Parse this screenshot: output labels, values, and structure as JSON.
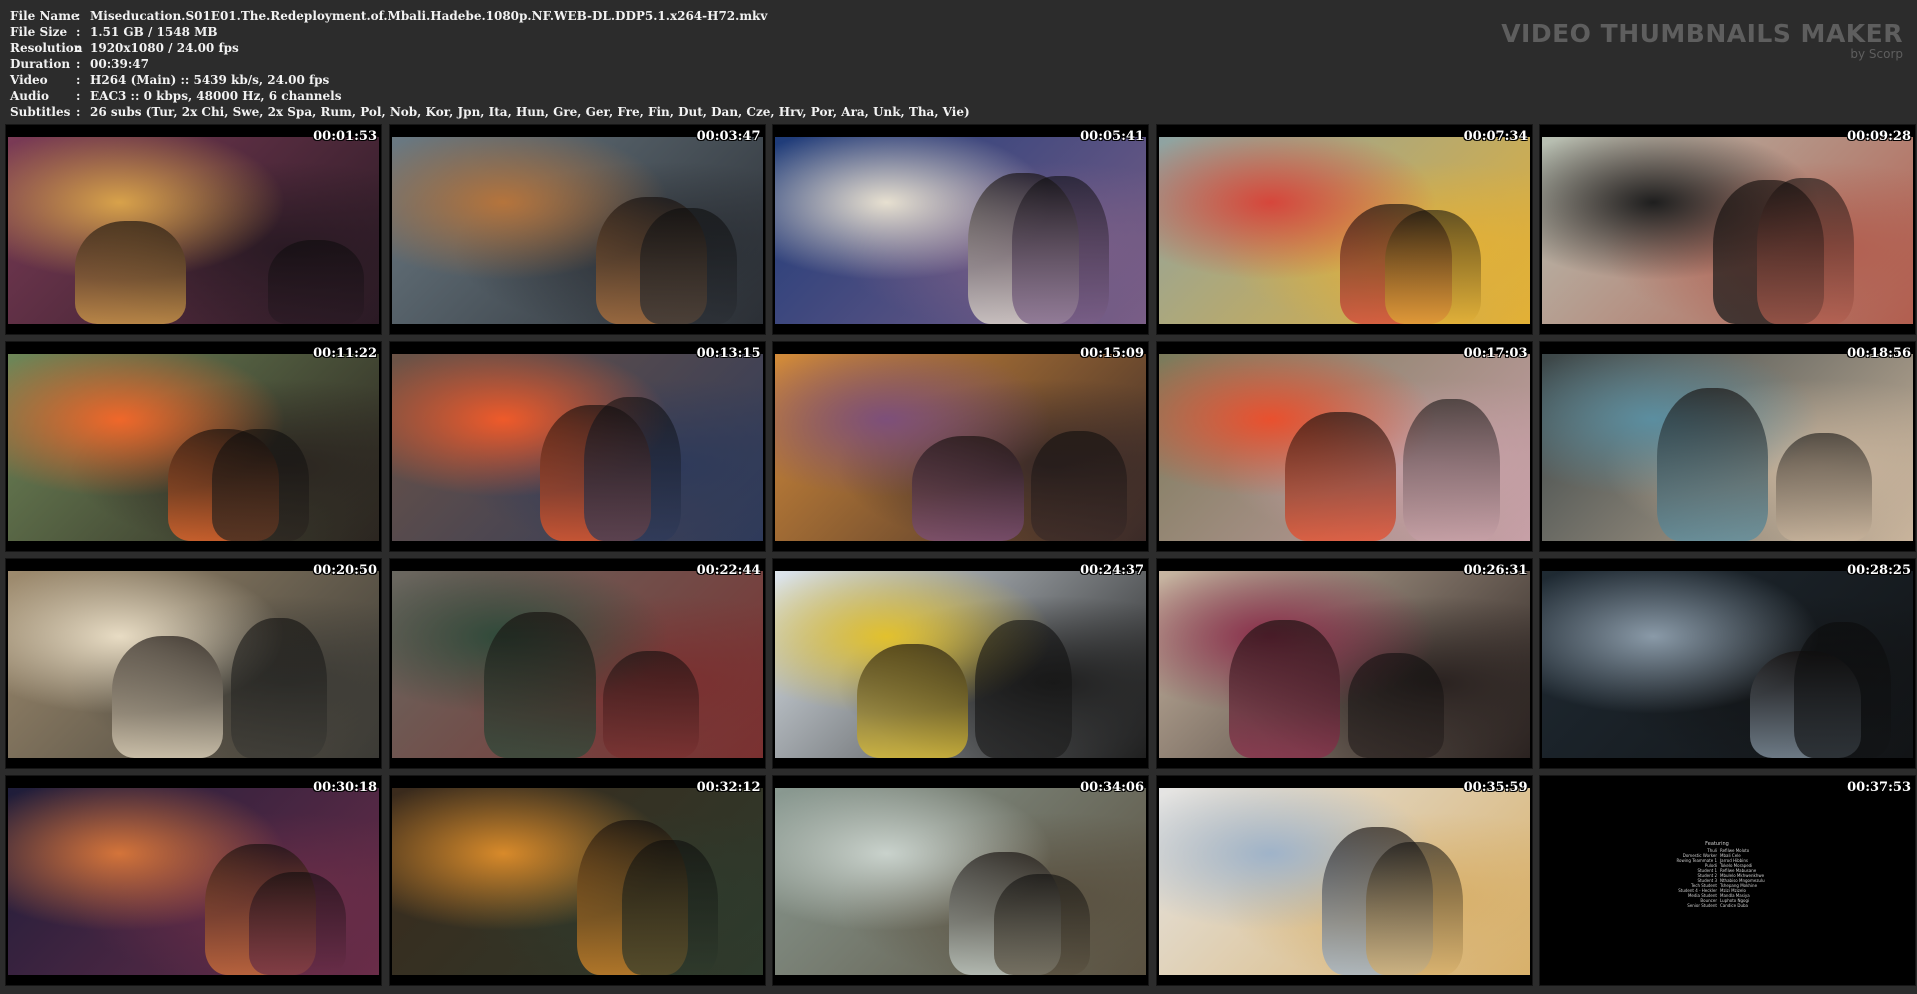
{
  "info": [
    {
      "key": "File Name",
      "value": "Miseducation.S01E01.The.Redeployment.of.Mbali.Hadebe.1080p.NF.WEB-DL.DDP5.1.x264-H72.mkv"
    },
    {
      "key": "File Size",
      "value": "1.51 GB  / 1548 MB"
    },
    {
      "key": "Resolution",
      "value": "1920x1080 / 24.00 fps"
    },
    {
      "key": "Duration",
      "value": "00:39:47"
    },
    {
      "key": "Video",
      "value": "H264 (Main) :: 5439 kb/s, 24.00 fps"
    },
    {
      "key": "Audio",
      "value": "EAC3 :: 0 kbps, 48000 Hz, 6 channels"
    },
    {
      "key": "Subtitles",
      "value": "26 subs (Tur, 2x Chi, Swe, 2x Spa, Rum, Pol, Nob, Kor, Jpn, Ita, Hun, Gre, Ger, Fre, Fin, Dut, Dan, Cze, Hrv, Por, Ara, Unk, Tha, Vie)"
    }
  ],
  "separator": ":",
  "brand": {
    "title": "VIDEO THUMBNAILS MAKER",
    "subtitle": "by Scorp"
  },
  "thumbnails": [
    {
      "time": "00:01:53",
      "scene": "social-live-stream",
      "c1": "#7b3b56",
      "c2": "#d8a24a",
      "c3": "#2a1a24"
    },
    {
      "time": "00:03:47",
      "scene": "crowd-arrival",
      "c1": "#6b7a83",
      "c2": "#b5743c",
      "c3": "#2b2f35"
    },
    {
      "time": "00:05:41",
      "scene": "neon-mb-sign",
      "c1": "#1e3c7a",
      "c2": "#e7e0d0",
      "c3": "#7a5e86"
    },
    {
      "time": "00:07:34",
      "scene": "blue-headscarf",
      "c1": "#8ea3a3",
      "c2": "#d6463b",
      "c3": "#e3b035"
    },
    {
      "time": "00:09:28",
      "scene": "street-car",
      "c1": "#b7c0b3",
      "c2": "#1e1e1e",
      "c3": "#b25e4f"
    },
    {
      "time": "00:11:22",
      "scene": "orange-fur-coat",
      "c1": "#6f8758",
      "c2": "#f0672a",
      "c3": "#2b2520"
    },
    {
      "time": "00:13:15",
      "scene": "office-teacher",
      "c1": "#6c5346",
      "c2": "#ef5a2a",
      "c3": "#2e3a5a"
    },
    {
      "time": "00:15:09",
      "scene": "campus-crowd",
      "c1": "#d38b3a",
      "c2": "#7d4f7a",
      "c3": "#3a2a28"
    },
    {
      "time": "00:17:03",
      "scene": "garden-group",
      "c1": "#7b7a5a",
      "c2": "#e9502e",
      "c3": "#c7a0a7"
    },
    {
      "time": "00:18:56",
      "scene": "lecture-hall",
      "c1": "#3a4547",
      "c2": "#5b8ea0",
      "c3": "#c9b49c"
    },
    {
      "time": "00:20:50",
      "scene": "school-corridor",
      "c1": "#9e8b6e",
      "c2": "#e8dcc4",
      "c3": "#3b3a35"
    },
    {
      "time": "00:22:44",
      "scene": "varsity-jacket",
      "c1": "#6a6860",
      "c2": "#2f4a3a",
      "c3": "#7a3030"
    },
    {
      "time": "00:24:37",
      "scene": "rowing-boat",
      "c1": "#dfe7ee",
      "c2": "#e2c12d",
      "c3": "#1f1f1f"
    },
    {
      "time": "00:26:31",
      "scene": "dorm-room",
      "c1": "#c9b7a3",
      "c2": "#8a2d4a",
      "c3": "#2a2220"
    },
    {
      "time": "00:28:25",
      "scene": "car-interior",
      "c1": "#1f2a33",
      "c2": "#8a9aa8",
      "c3": "#121416"
    },
    {
      "time": "00:30:18",
      "scene": "video-call",
      "c1": "#1e1d3a",
      "c2": "#d4743a",
      "c3": "#6a2d48"
    },
    {
      "time": "00:32:12",
      "scene": "warm-room",
      "c1": "#3a2a1c",
      "c2": "#d88a2a",
      "c3": "#2e3a2c"
    },
    {
      "time": "00:34:06",
      "scene": "river-rowers",
      "c1": "#8a9a92",
      "c2": "#c9d2cc",
      "c3": "#5a5140"
    },
    {
      "time": "00:35:59",
      "scene": "ball-pit-bath",
      "c1": "#e5e5e5",
      "c2": "#9fb3c9",
      "c3": "#d8b06a"
    },
    {
      "time": "00:37:53",
      "scene": "end-credits",
      "c1": "#000000",
      "c2": "#000000",
      "c3": "#000000"
    }
  ],
  "credits": {
    "heading": "Featuring",
    "rows": [
      [
        "Thuli",
        "Refilwe Moloto"
      ],
      [
        "Domestic Worker",
        "Mbali Cele"
      ],
      [
        "Rowing Teammate 1",
        "Jarrod Hibbins"
      ],
      [
        "Pulodi",
        "Tokelo Morapedi"
      ],
      [
        "Student 1",
        "Refilwe Mabusane"
      ],
      [
        "Student 2",
        "Mbulelo Mkhwenkhwe"
      ],
      [
        "Student 3",
        "Nthabiso Mngomezulu"
      ],
      [
        "Tech Student",
        "Tshepang Mokhine"
      ],
      [
        "Student 4 - Heckler",
        "Mzizi Mzizelo"
      ],
      [
        "Media Student",
        "Mandla Masiya"
      ],
      [
        "Bouncer",
        "Luphoto Ngogi"
      ],
      [
        "Senior Student",
        "Candice Duba"
      ]
    ]
  }
}
